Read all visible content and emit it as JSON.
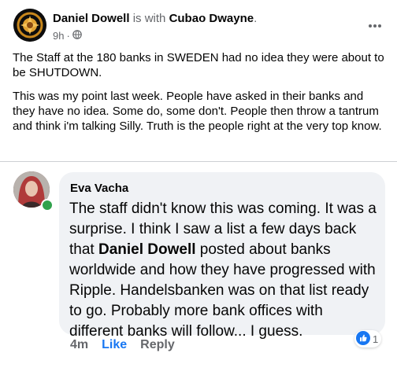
{
  "post": {
    "author": "Daniel Dowell",
    "with_text": "is with",
    "tagged": "Cubao Dwayne",
    "tagged_suffix": ".",
    "time": "9h",
    "separator": "·",
    "privacy_icon": "globe-icon",
    "more_icon": "more-horizontal-icon",
    "paragraphs": [
      "The Staff at the 180 banks in SWEDEN had no idea they were about to be SHUTDOWN.",
      "This was my point last week. People have asked in their banks and they have no idea. Some do, some don't. People then throw a tantrum and think i'm talking Silly. Truth is the people right at the very top know."
    ]
  },
  "comment": {
    "author": "Eva Vacha",
    "text_before": "The staff didn't know this was coming. It was a surprise. I think I saw a list a few days back that ",
    "mention": "Daniel Dowell",
    "text_after": " posted about banks worldwide and how they have progressed with Ripple. Handelsbanken was on that list ready to go. Probably more bank offices with different banks will follow... I guess.",
    "time": "4m",
    "like_label": "Like",
    "reply_label": "Reply",
    "reaction_count": "1",
    "reaction_icon": "like-icon",
    "online_status_color": "#31a24c"
  },
  "colors": {
    "link_blue": "#1877f2",
    "muted": "#65676b",
    "bubble_bg": "#f0f2f5"
  }
}
